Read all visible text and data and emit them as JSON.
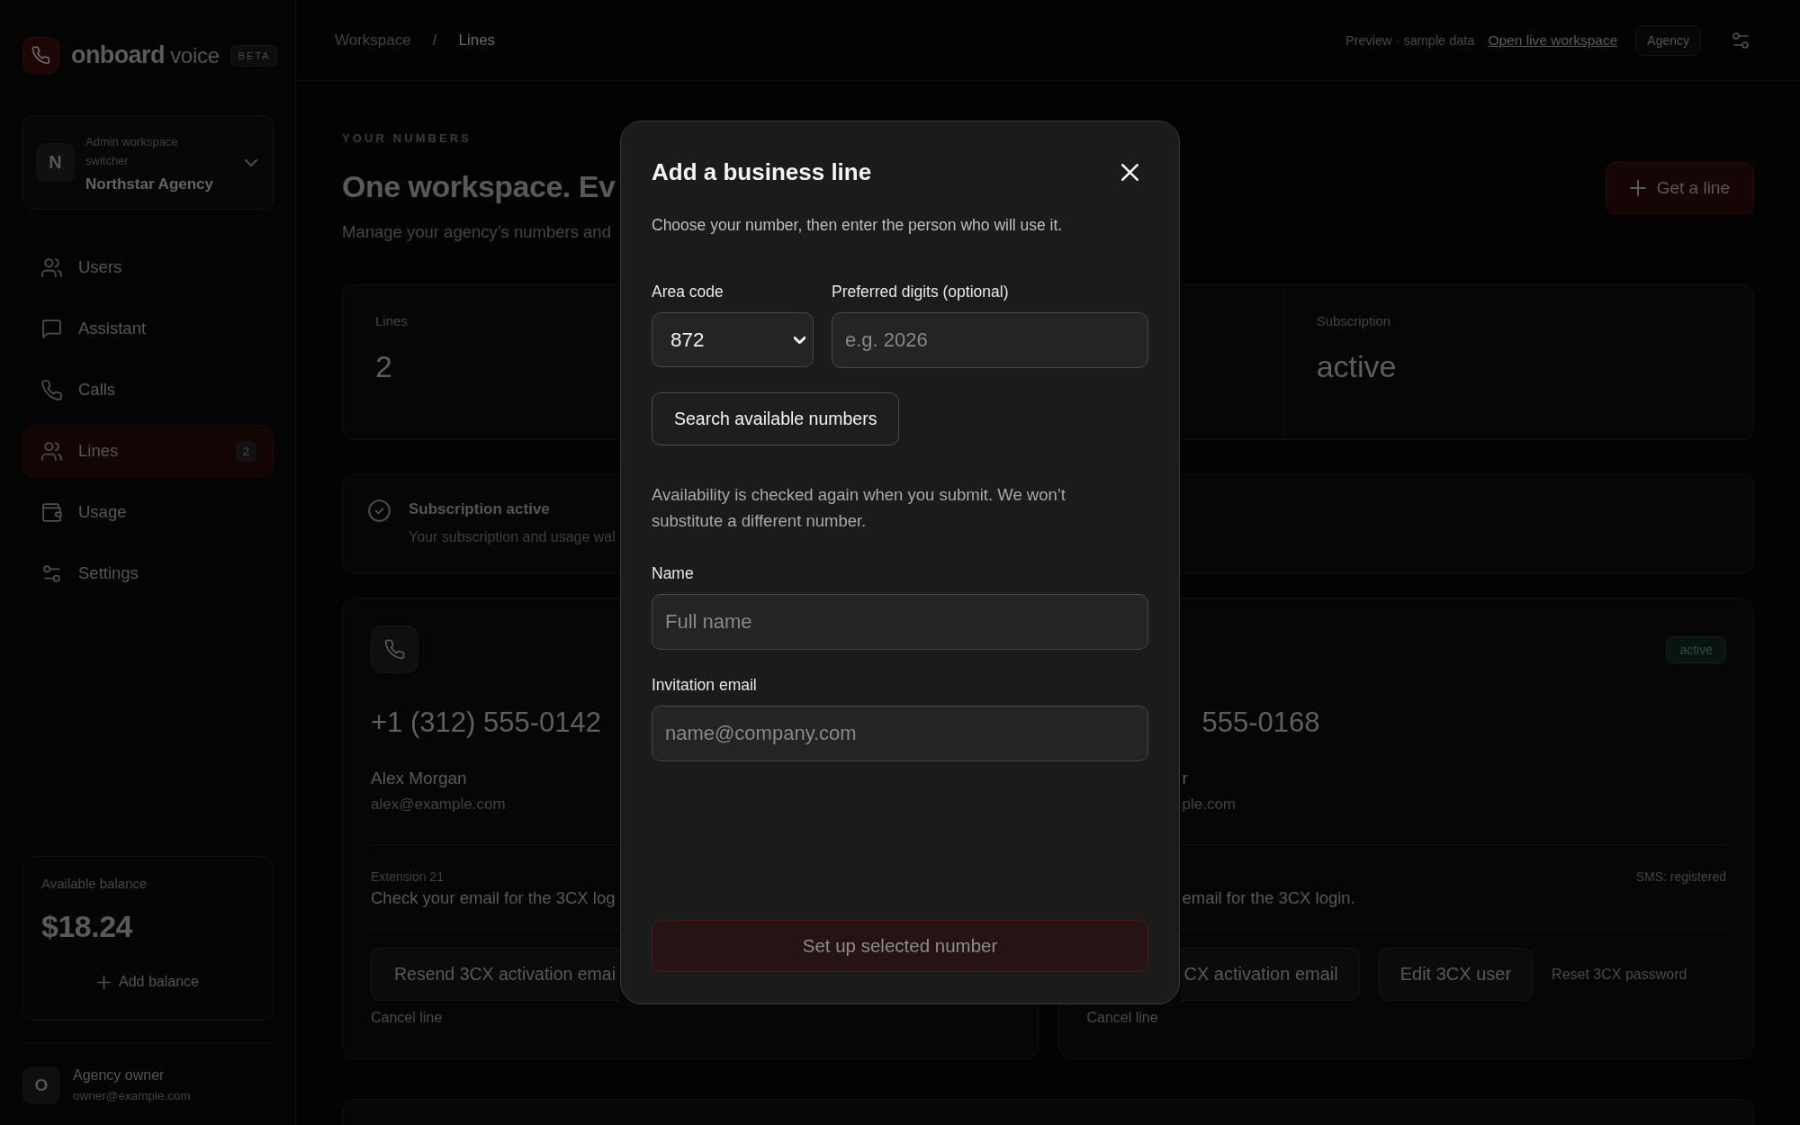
{
  "sidebar": {
    "brand": "**onboard** voice",
    "badge": "BETA",
    "workspace_switcher": {
      "initial": "N",
      "label": "Admin workspace switcher",
      "name": "Northstar Agency"
    },
    "nav": [
      {
        "label": "Users",
        "selected": false
      },
      {
        "label": "Assistant",
        "selected": false
      },
      {
        "label": "Calls",
        "selected": false
      },
      {
        "label": "Lines",
        "selected": true,
        "count": "2"
      },
      {
        "label": "Usage",
        "selected": false
      },
      {
        "label": "Settings",
        "selected": false
      }
    ],
    "balance": {
      "label": "Available balance",
      "amount": "$18.24",
      "action": "Add balance"
    },
    "user": {
      "initial": "O",
      "role": "Agency owner",
      "email": "owner@example.com"
    }
  },
  "top_bar": {
    "breadcrumb": [
      {
        "label": "Workspace",
        "current": false
      },
      {
        "label": "Lines",
        "current": true
      }
    ],
    "separator": "/",
    "preview_note": "Preview · sample data",
    "live_link": "Open live workspace",
    "role_badge": "Agency"
  },
  "header": {
    "eyebrow": "YOUR NUMBERS",
    "title": "One workspace. Ev",
    "description": "Manage your agency’s numbers and",
    "action": "Get a line"
  },
  "stats": [
    {
      "label": "Lines",
      "value": "2"
    },
    {
      "label": "Subscription",
      "value": "active"
    }
  ],
  "banner": {
    "title": "Subscription active",
    "text": "Your subscription and usage wal"
  },
  "lines": [
    {
      "number": "+1 (312) 555-0142",
      "name": "Alex Morgan",
      "email": "alex@example.com",
      "extension": "Extension 21",
      "note": "Check your email for the 3CX log",
      "actions": [
        {
          "kind": "button",
          "label": "Resend 3CX activation emai"
        }
      ],
      "cancel": "Cancel line"
    },
    {
      "status": "active",
      "number": "555-0168",
      "name": "r",
      "email": "ple.com",
      "sms": "SMS: registered",
      "note": "email for the 3CX login.",
      "actions": [
        {
          "kind": "button",
          "label": "CX activation email"
        },
        {
          "kind": "button",
          "label": "Edit 3CX user"
        },
        {
          "kind": "link",
          "label": "Reset 3CX password"
        }
      ],
      "cancel": "Cancel line"
    }
  ],
  "dialog": {
    "title": "Add a business line",
    "subtitle": "Choose your number, then enter the person who will use it.",
    "area_code": {
      "label": "Area code",
      "value": "872"
    },
    "digits": {
      "label": "Preferred digits (optional)",
      "placeholder": "e.g. 2026"
    },
    "search": "Search available numbers",
    "notice": "Availability is checked again when you submit. We won’t substitute a different number.",
    "name": {
      "label": "Name",
      "placeholder": "Full name"
    },
    "email": {
      "label": "Invitation email",
      "placeholder": "name@company.com"
    },
    "submit": {
      "label": "Set up selected number",
      "disabled": true
    }
  }
}
